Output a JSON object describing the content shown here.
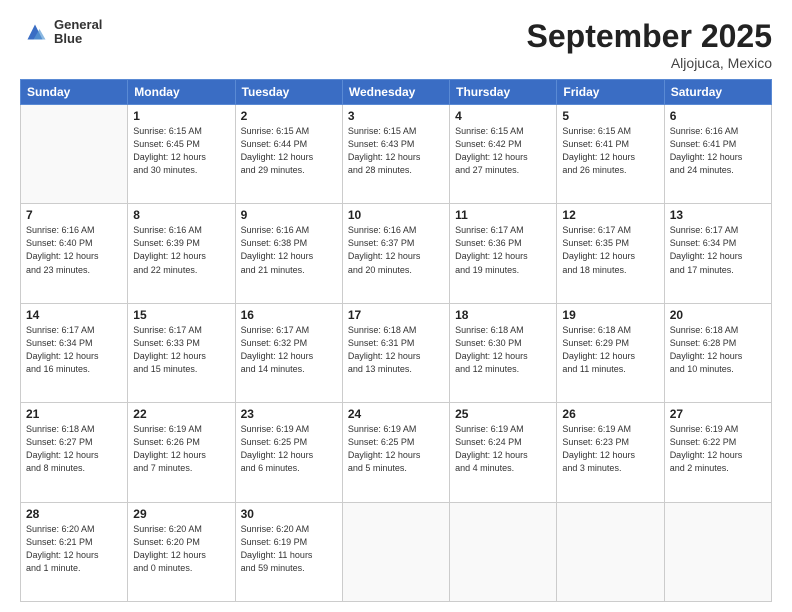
{
  "logo": {
    "line1": "General",
    "line2": "Blue"
  },
  "title": "September 2025",
  "subtitle": "Aljojuca, Mexico",
  "days_of_week": [
    "Sunday",
    "Monday",
    "Tuesday",
    "Wednesday",
    "Thursday",
    "Friday",
    "Saturday"
  ],
  "weeks": [
    [
      {
        "day": "",
        "info": ""
      },
      {
        "day": "1",
        "info": "Sunrise: 6:15 AM\nSunset: 6:45 PM\nDaylight: 12 hours\nand 30 minutes."
      },
      {
        "day": "2",
        "info": "Sunrise: 6:15 AM\nSunset: 6:44 PM\nDaylight: 12 hours\nand 29 minutes."
      },
      {
        "day": "3",
        "info": "Sunrise: 6:15 AM\nSunset: 6:43 PM\nDaylight: 12 hours\nand 28 minutes."
      },
      {
        "day": "4",
        "info": "Sunrise: 6:15 AM\nSunset: 6:42 PM\nDaylight: 12 hours\nand 27 minutes."
      },
      {
        "day": "5",
        "info": "Sunrise: 6:15 AM\nSunset: 6:41 PM\nDaylight: 12 hours\nand 26 minutes."
      },
      {
        "day": "6",
        "info": "Sunrise: 6:16 AM\nSunset: 6:41 PM\nDaylight: 12 hours\nand 24 minutes."
      }
    ],
    [
      {
        "day": "7",
        "info": "Sunrise: 6:16 AM\nSunset: 6:40 PM\nDaylight: 12 hours\nand 23 minutes."
      },
      {
        "day": "8",
        "info": "Sunrise: 6:16 AM\nSunset: 6:39 PM\nDaylight: 12 hours\nand 22 minutes."
      },
      {
        "day": "9",
        "info": "Sunrise: 6:16 AM\nSunset: 6:38 PM\nDaylight: 12 hours\nand 21 minutes."
      },
      {
        "day": "10",
        "info": "Sunrise: 6:16 AM\nSunset: 6:37 PM\nDaylight: 12 hours\nand 20 minutes."
      },
      {
        "day": "11",
        "info": "Sunrise: 6:17 AM\nSunset: 6:36 PM\nDaylight: 12 hours\nand 19 minutes."
      },
      {
        "day": "12",
        "info": "Sunrise: 6:17 AM\nSunset: 6:35 PM\nDaylight: 12 hours\nand 18 minutes."
      },
      {
        "day": "13",
        "info": "Sunrise: 6:17 AM\nSunset: 6:34 PM\nDaylight: 12 hours\nand 17 minutes."
      }
    ],
    [
      {
        "day": "14",
        "info": "Sunrise: 6:17 AM\nSunset: 6:34 PM\nDaylight: 12 hours\nand 16 minutes."
      },
      {
        "day": "15",
        "info": "Sunrise: 6:17 AM\nSunset: 6:33 PM\nDaylight: 12 hours\nand 15 minutes."
      },
      {
        "day": "16",
        "info": "Sunrise: 6:17 AM\nSunset: 6:32 PM\nDaylight: 12 hours\nand 14 minutes."
      },
      {
        "day": "17",
        "info": "Sunrise: 6:18 AM\nSunset: 6:31 PM\nDaylight: 12 hours\nand 13 minutes."
      },
      {
        "day": "18",
        "info": "Sunrise: 6:18 AM\nSunset: 6:30 PM\nDaylight: 12 hours\nand 12 minutes."
      },
      {
        "day": "19",
        "info": "Sunrise: 6:18 AM\nSunset: 6:29 PM\nDaylight: 12 hours\nand 11 minutes."
      },
      {
        "day": "20",
        "info": "Sunrise: 6:18 AM\nSunset: 6:28 PM\nDaylight: 12 hours\nand 10 minutes."
      }
    ],
    [
      {
        "day": "21",
        "info": "Sunrise: 6:18 AM\nSunset: 6:27 PM\nDaylight: 12 hours\nand 8 minutes."
      },
      {
        "day": "22",
        "info": "Sunrise: 6:19 AM\nSunset: 6:26 PM\nDaylight: 12 hours\nand 7 minutes."
      },
      {
        "day": "23",
        "info": "Sunrise: 6:19 AM\nSunset: 6:25 PM\nDaylight: 12 hours\nand 6 minutes."
      },
      {
        "day": "24",
        "info": "Sunrise: 6:19 AM\nSunset: 6:25 PM\nDaylight: 12 hours\nand 5 minutes."
      },
      {
        "day": "25",
        "info": "Sunrise: 6:19 AM\nSunset: 6:24 PM\nDaylight: 12 hours\nand 4 minutes."
      },
      {
        "day": "26",
        "info": "Sunrise: 6:19 AM\nSunset: 6:23 PM\nDaylight: 12 hours\nand 3 minutes."
      },
      {
        "day": "27",
        "info": "Sunrise: 6:19 AM\nSunset: 6:22 PM\nDaylight: 12 hours\nand 2 minutes."
      }
    ],
    [
      {
        "day": "28",
        "info": "Sunrise: 6:20 AM\nSunset: 6:21 PM\nDaylight: 12 hours\nand 1 minute."
      },
      {
        "day": "29",
        "info": "Sunrise: 6:20 AM\nSunset: 6:20 PM\nDaylight: 12 hours\nand 0 minutes."
      },
      {
        "day": "30",
        "info": "Sunrise: 6:20 AM\nSunset: 6:19 PM\nDaylight: 11 hours\nand 59 minutes."
      },
      {
        "day": "",
        "info": ""
      },
      {
        "day": "",
        "info": ""
      },
      {
        "day": "",
        "info": ""
      },
      {
        "day": "",
        "info": ""
      }
    ]
  ]
}
